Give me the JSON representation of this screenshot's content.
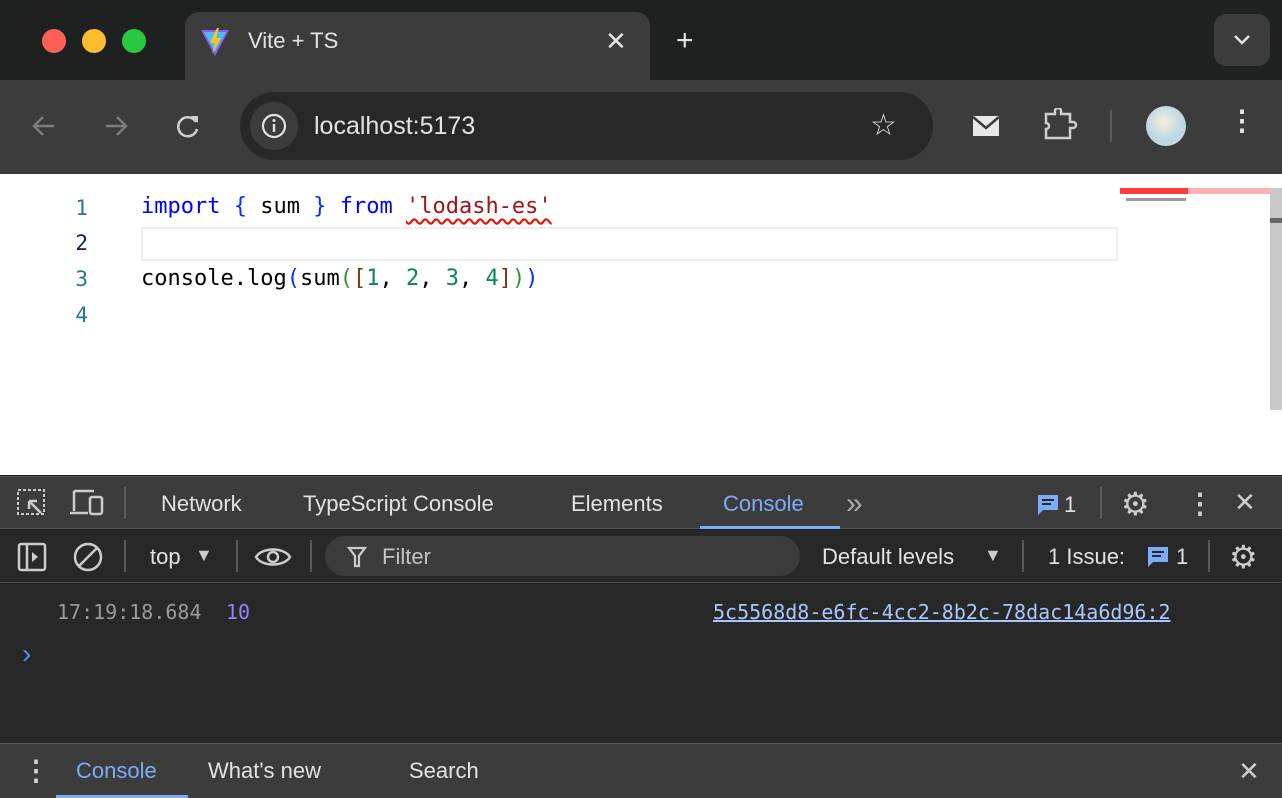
{
  "browser": {
    "tab_title": "Vite + TS",
    "url": "localhost:5173",
    "icons": [
      "vite-logo-icon",
      "close-icon",
      "plus-icon",
      "chevron-down-icon",
      "back-icon",
      "forward-icon",
      "reload-icon",
      "info-icon",
      "star-icon",
      "mail-icon",
      "extension-puzzle-icon",
      "avatar",
      "more-vert-icon"
    ]
  },
  "editor": {
    "line_numbers": [
      "1",
      "2",
      "3",
      "4"
    ],
    "line1": {
      "kw1": "import",
      "brace_open": " { ",
      "ident": "sum",
      "brace_close": " } ",
      "kw2": "from",
      "string": "'lodash-es'"
    },
    "line3": {
      "obj": "console.log",
      "p1": "(",
      "fn": "sum",
      "p2": "(",
      "b1": "[",
      "n1": "1",
      "c1": ", ",
      "n2": "2",
      "c2": ", ",
      "n3": "3",
      "c3": ", ",
      "n4": "4",
      "b2": "]",
      "p3": ")",
      "p4": ")"
    }
  },
  "devtools": {
    "tabs": [
      "Network",
      "TypeScript Console",
      "Elements",
      "Console"
    ],
    "active_tab": "Console",
    "more_tabs": "»",
    "message_count": "1",
    "context": "top",
    "filter_placeholder": "Filter",
    "levels": "Default levels",
    "issues_label": "1 Issue:",
    "issues_count": "1",
    "log": {
      "timestamp": "17:19:18.684",
      "value": "10",
      "source": "5c5568d8-e6fc-4cc2-8b2c-78dac14a6d96:2"
    },
    "prompt": "›",
    "drawer_tabs": [
      "Console",
      "What's new",
      "Search"
    ],
    "accent": "#7cacf8"
  }
}
